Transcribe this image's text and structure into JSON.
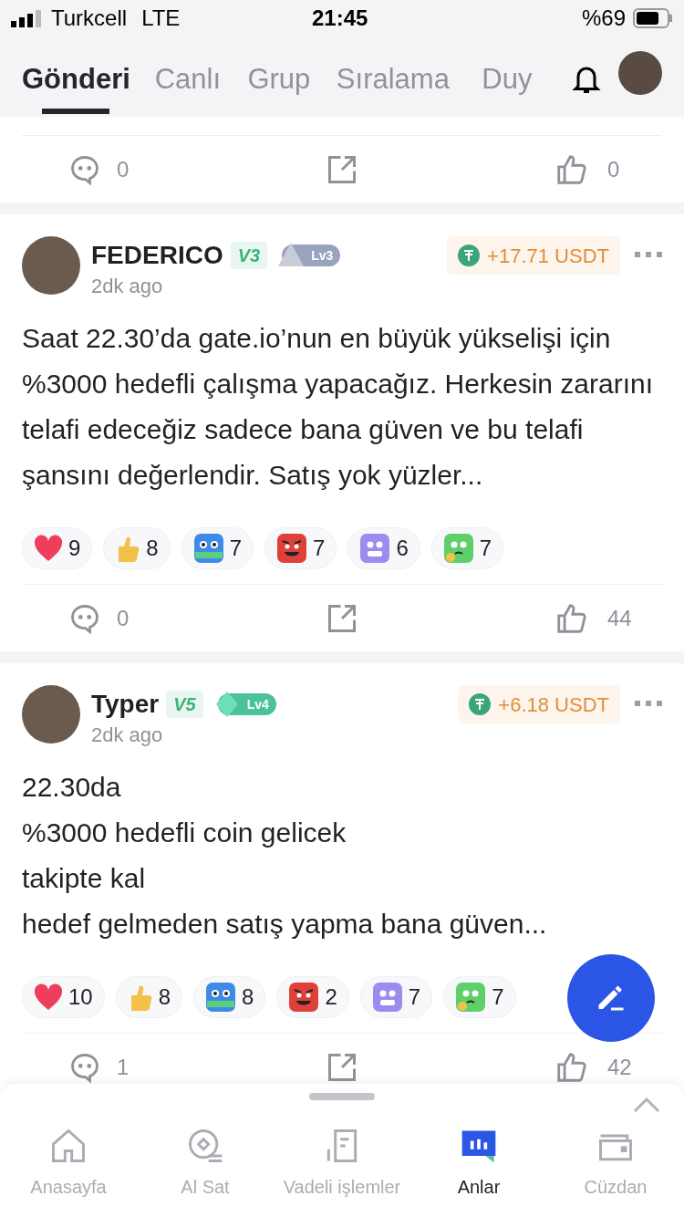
{
  "status_bar": {
    "carrier": "Turkcell",
    "network": "LTE",
    "time": "21:45",
    "battery_text": "%69"
  },
  "tabs": [
    {
      "label": "Gönderi",
      "selected": true
    },
    {
      "label": "Canlı",
      "selected": false
    },
    {
      "label": "Grup",
      "selected": false
    },
    {
      "label": "Sıralama",
      "selected": false
    },
    {
      "label": "Duy",
      "selected": false
    }
  ],
  "previous_post_actions": {
    "comments": "0",
    "likes": "0"
  },
  "posts": [
    {
      "author": "FEDERICO",
      "vip": "V3",
      "level": {
        "kind": "silver",
        "label": "Lv3"
      },
      "time": "2dk ago",
      "profit": "+17.71 USDT",
      "text": [
        "Saat 22.30’da gate.io’nun en büyük yükselişi için %3000 hedefli çalışma yapacağız. Herkesin zararını telafi edeceğiz sadece bana güven ve bu telafi şansını değerlendir. Satış yok yüzler..."
      ],
      "reactions": [
        {
          "kind": "heart",
          "count": "9"
        },
        {
          "kind": "thumb",
          "count": "8"
        },
        {
          "kind": "hodl",
          "count": "7"
        },
        {
          "kind": "angry",
          "count": "7"
        },
        {
          "kind": "scared",
          "count": "6"
        },
        {
          "kind": "thinking",
          "count": "7"
        }
      ],
      "comments": "0",
      "likes": "44"
    },
    {
      "author": "Typer",
      "vip": "V5",
      "level": {
        "kind": "diamond",
        "label": "Lv4"
      },
      "time": "2dk ago",
      "profit": "+6.18 USDT",
      "text": [
        "22.30da",
        "%3000 hedefli coin gelicek",
        "takipte kal",
        "hedef gelmeden satış yapma bana güven..."
      ],
      "reactions": [
        {
          "kind": "heart",
          "count": "10"
        },
        {
          "kind": "thumb",
          "count": "8"
        },
        {
          "kind": "hodl",
          "count": "8"
        },
        {
          "kind": "angry",
          "count": "2"
        },
        {
          "kind": "scared",
          "count": "7"
        },
        {
          "kind": "thinking",
          "count": "7"
        }
      ],
      "comments": "1",
      "likes": "42"
    }
  ],
  "bottom_nav": [
    {
      "kind": "home",
      "label": "Anasayfa",
      "selected": false
    },
    {
      "kind": "trade",
      "label": "Al Sat",
      "selected": false
    },
    {
      "kind": "futures",
      "label": "Vadeli işlemler",
      "selected": false
    },
    {
      "kind": "moments",
      "label": "Anlar",
      "selected": true
    },
    {
      "kind": "wallet",
      "label": "Cüzdan",
      "selected": false
    }
  ]
}
